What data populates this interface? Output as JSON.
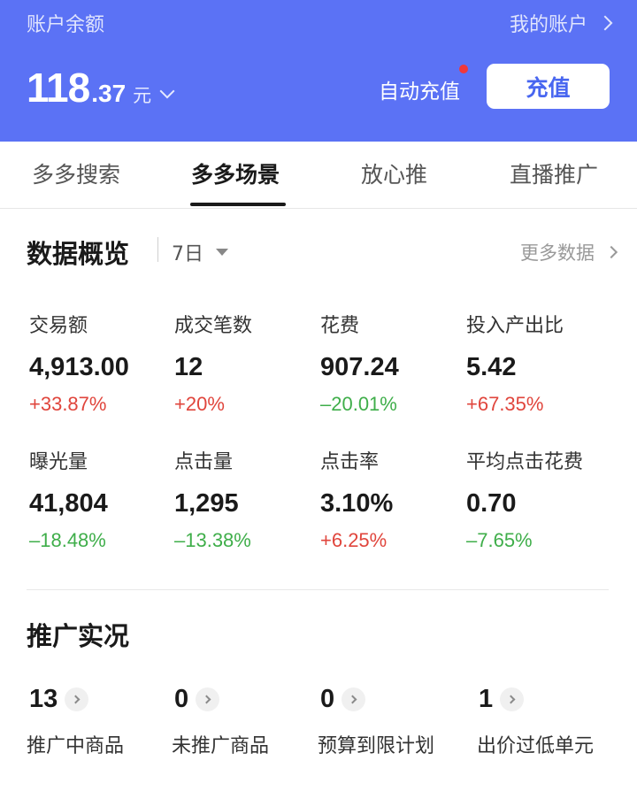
{
  "header": {
    "account_label": "账户余额",
    "my_account": "我的账户",
    "balance_int": "118",
    "balance_dec": ".37",
    "balance_unit": "元",
    "auto_recharge": "自动充值",
    "recharge_button": "充值"
  },
  "tabs": [
    {
      "label": "多多搜索",
      "active": false
    },
    {
      "label": "多多场景",
      "active": true
    },
    {
      "label": "放心推",
      "active": false
    },
    {
      "label": "直播推广",
      "active": false
    }
  ],
  "overview": {
    "title": "数据概览",
    "period": "7日",
    "more": "更多数据",
    "metrics": [
      {
        "label": "交易额",
        "value": "4,913.00",
        "change": "+33.87%",
        "trend": "up"
      },
      {
        "label": "成交笔数",
        "value": "12",
        "change": "+20%",
        "trend": "up"
      },
      {
        "label": "花费",
        "value": "907.24",
        "change": "–20.01%",
        "trend": "down"
      },
      {
        "label": "投入产出比",
        "value": "5.42",
        "change": "+67.35%",
        "trend": "up"
      },
      {
        "label": "曝光量",
        "value": "41,804",
        "change": "–18.48%",
        "trend": "down"
      },
      {
        "label": "点击量",
        "value": "1,295",
        "change": "–13.38%",
        "trend": "down"
      },
      {
        "label": "点击率",
        "value": "3.10%",
        "change": "+6.25%",
        "trend": "up"
      },
      {
        "label": "平均点击花费",
        "value": "0.70",
        "change": "–7.65%",
        "trend": "down"
      }
    ]
  },
  "promo": {
    "title": "推广实况",
    "stats": [
      {
        "value": "13",
        "label": "推广中商品"
      },
      {
        "value": "0",
        "label": "未推广商品"
      },
      {
        "value": "0",
        "label": "预算到限计划"
      },
      {
        "value": "1",
        "label": "出价过低单元"
      }
    ]
  },
  "colors": {
    "header_bg": "#5b72f5",
    "accent": "#4866f0",
    "up": "#e0453c",
    "down": "#3fae4a",
    "dot": "#f0383a"
  }
}
